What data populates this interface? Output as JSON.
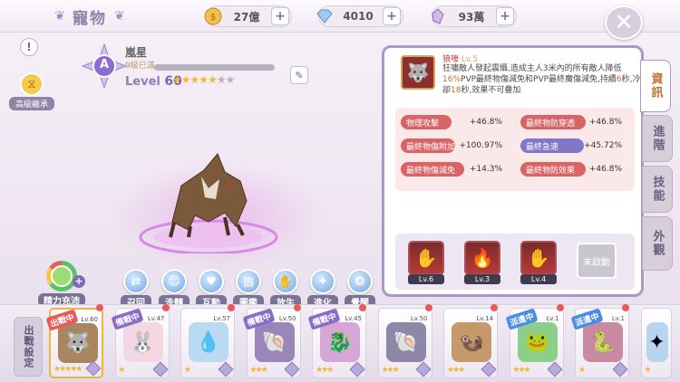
{
  "header": {
    "title": "寵物",
    "currencies": [
      {
        "icon": "gold-coin-icon",
        "value": "27億"
      },
      {
        "icon": "diamond-icon",
        "value": "4010"
      },
      {
        "icon": "crystal-icon",
        "value": "93萬"
      }
    ],
    "close_icon": "close-icon",
    "info_icon": "info-icon"
  },
  "left_header": {
    "inherit_label": "高級繼承",
    "emblem_letter": "A",
    "pet_name": "嵐星",
    "pet_subtitle": "9級已滿",
    "level_label": "Level",
    "level_value": "60",
    "stars_filled": 5,
    "stars_total": 7
  },
  "actions": {
    "energy_label": "精力充沛",
    "buttons": [
      {
        "label": "召回",
        "icon": "recall-icon"
      },
      {
        "label": "洗髓",
        "icon": "reroll-icon"
      },
      {
        "label": "互動",
        "icon": "heart-icon"
      },
      {
        "label": "圖鑑",
        "icon": "book-icon"
      },
      {
        "label": "放生",
        "icon": "release-icon"
      },
      {
        "label": "進化",
        "icon": "evolve-icon"
      },
      {
        "label": "覺醒",
        "icon": "awaken-icon"
      }
    ]
  },
  "skill": {
    "name": "狼嚎",
    "level": "Lv.5",
    "desc_parts": [
      "狂嘯敵人發起震懾,造成主人3米內的所有敵人降低",
      "16%",
      "PVP最終物傷減免和PVP最終魔傷減免,持續",
      "6",
      "秒,冷卻",
      "18",
      "秒,效果不可疊加"
    ]
  },
  "stats": [
    {
      "name": "物理攻擊",
      "value": "+46.8%"
    },
    {
      "name": "最終物防穿透",
      "value": "+46.8%"
    },
    {
      "name": "最終物傷附加",
      "value": "+100.97%"
    },
    {
      "name": "最終急速",
      "value": "+45.72%"
    },
    {
      "name": "最終物傷減免",
      "value": "+14.3%"
    },
    {
      "name": "最終物防效果",
      "value": "+46.8%"
    }
  ],
  "skill_slots": [
    {
      "level": "Lv.6"
    },
    {
      "level": "Lv.3"
    },
    {
      "level": "Lv.4"
    }
  ],
  "unactivated_label": "未啟動",
  "tabs": [
    "資訊",
    "進階",
    "技能",
    "外觀"
  ],
  "deploy_label": "出戰設定",
  "cards": [
    {
      "tag": "出戰中",
      "tag_color": "red",
      "level": "Lv.60",
      "stars": 5
    },
    {
      "tag": "備戰中",
      "tag_color": "purple",
      "level": "Lv.47",
      "stars": 1
    },
    {
      "tag": "",
      "tag_color": "",
      "level": "Lv.57",
      "stars": 1
    },
    {
      "tag": "備戰中",
      "tag_color": "purple",
      "level": "Lv.50",
      "stars": 3
    },
    {
      "tag": "備戰中",
      "tag_color": "purple",
      "level": "Lv.45",
      "stars": 3
    },
    {
      "tag": "",
      "tag_color": "",
      "level": "Lv.50",
      "stars": 3
    },
    {
      "tag": "",
      "tag_color": "",
      "level": "Lv.14",
      "stars": 3
    },
    {
      "tag": "派遣中",
      "tag_color": "blue",
      "level": "Lv.1",
      "stars": 3
    },
    {
      "tag": "派遣中",
      "tag_color": "blue",
      "level": "Lv.1",
      "stars": 1
    },
    {
      "tag": "",
      "tag_color": "",
      "level": "",
      "stars": 1
    }
  ]
}
